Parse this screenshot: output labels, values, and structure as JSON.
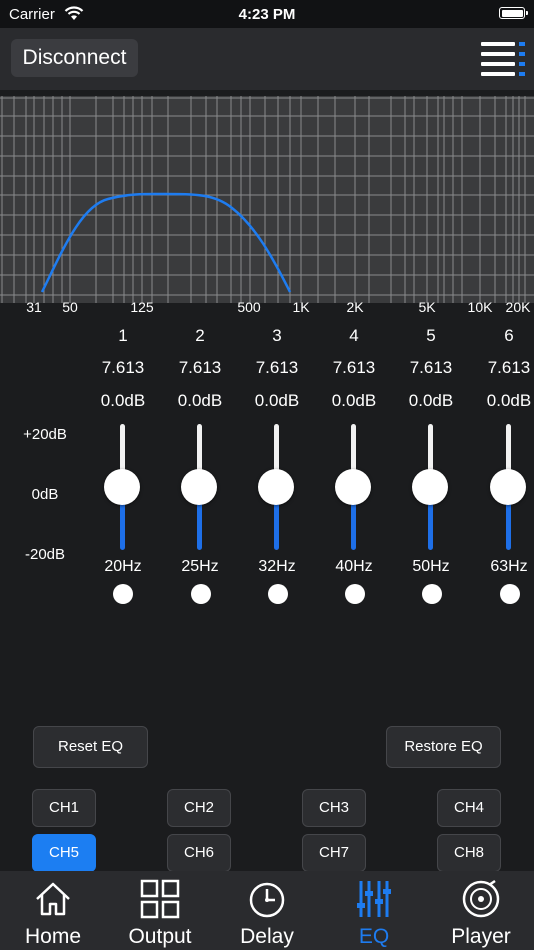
{
  "status": {
    "carrier": "Carrier",
    "time": "4:23 PM",
    "wifi_icon": "wifi-icon",
    "battery_icon": "battery-icon"
  },
  "topbar": {
    "disconnect_label": "Disconnect",
    "menu_icon": "menu-icon"
  },
  "graph": {
    "freq_labels": [
      "31",
      "50",
      "125",
      "500",
      "1K",
      "2K",
      "5K",
      "10K",
      "20K"
    ],
    "curve_color": "#1e7cf0"
  },
  "db_scale": {
    "top": "+20dB",
    "mid": "0dB",
    "bottom": "-20dB"
  },
  "bands": [
    {
      "num": "1",
      "q": "7.613",
      "gain": "0.0dB",
      "freq": "20Hz",
      "level": 0.5
    },
    {
      "num": "2",
      "q": "7.613",
      "gain": "0.0dB",
      "freq": "25Hz",
      "level": 0.5
    },
    {
      "num": "3",
      "q": "7.613",
      "gain": "0.0dB",
      "freq": "32Hz",
      "level": 0.5
    },
    {
      "num": "4",
      "q": "7.613",
      "gain": "0.0dB",
      "freq": "40Hz",
      "level": 0.5
    },
    {
      "num": "5",
      "q": "7.613",
      "gain": "0.0dB",
      "freq": "50Hz",
      "level": 0.5
    },
    {
      "num": "6",
      "q": "7.613",
      "gain": "0.0dB",
      "freq": "63Hz",
      "level": 0.5
    }
  ],
  "actions": {
    "reset_label": "Reset EQ",
    "restore_label": "Restore EQ"
  },
  "channels": [
    "CH1",
    "CH2",
    "CH3",
    "CH4",
    "CH5",
    "CH6",
    "CH7",
    "CH8"
  ],
  "active_channel": "CH5",
  "tabs": [
    {
      "label": "Home",
      "icon": "home-icon"
    },
    {
      "label": "Output",
      "icon": "grid-icon"
    },
    {
      "label": "Delay",
      "icon": "clock-icon"
    },
    {
      "label": "EQ",
      "icon": "equalizer-icon"
    },
    {
      "label": "Player",
      "icon": "disc-icon"
    }
  ],
  "active_tab": "EQ",
  "colors": {
    "accent": "#1e7cf0",
    "background": "#1b1c1e",
    "bar": "#2a2b2e",
    "graph_bg": "#3a3b3d"
  }
}
